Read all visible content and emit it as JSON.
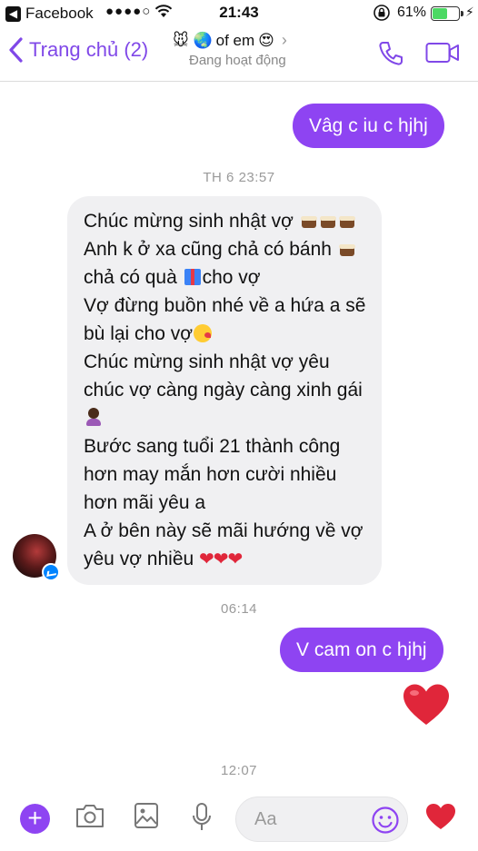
{
  "status_bar": {
    "back_app": "Facebook",
    "signal": "●●●●○",
    "time": "21:43",
    "battery_pct": "61%",
    "battery_level": 0.61
  },
  "header": {
    "back_label": "Trang chủ (2)",
    "title_emoji": "🐭 🌏",
    "title_text": "of em",
    "title_emoji_end": "😍",
    "subtitle": "Đang hoạt động"
  },
  "messages": {
    "out_1": "Vâg c iu c hjhj",
    "stamp_1": "TH 6 23:57",
    "in_1": {
      "l1": "Chúc mừng sinh nhật vợ",
      "l2": "Anh k ở xa cũng chả có bánh",
      "l3a": "chả có quà",
      "l3b": "cho vợ",
      "l4": "Vợ đừng buồn nhé về a hứa a sẽ",
      "l5": "bù lại cho vợ",
      "l6": "Chúc mừng sinh nhật vợ yêu",
      "l7": "chúc vợ càng ngày càng xinh gái",
      "l9": "Bước sang tuổi 21 thành công",
      "l10": "hơn may mắn hơn cười nhiều",
      "l11": "hơn mãi yêu a",
      "l12": "A ở bên này sẽ mãi hướng về vợ",
      "l13": "yêu vợ nhiều",
      "hearts": "❤❤❤"
    },
    "stamp_2": "06:14",
    "out_2": "V cam on c hjhj",
    "stamp_3": "12:07"
  },
  "composer": {
    "placeholder": "Aa",
    "plus": "+"
  },
  "colors": {
    "accent": "#8e44f2",
    "heart": "#e0263a",
    "incoming_bubble": "#f0f0f2"
  }
}
